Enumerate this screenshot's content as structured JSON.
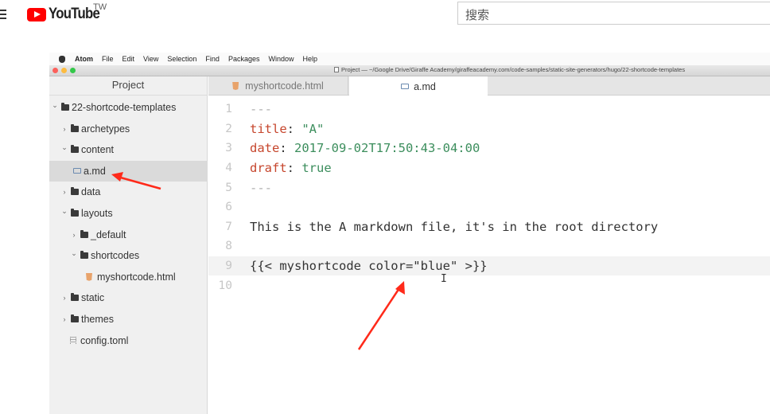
{
  "youtube": {
    "logo_text": "YouTube",
    "region": "TW",
    "search_placeholder": "搜索"
  },
  "menubar": {
    "items": [
      "Atom",
      "File",
      "Edit",
      "View",
      "Selection",
      "Find",
      "Packages",
      "Window",
      "Help"
    ]
  },
  "window": {
    "title": "Project — ~/Google Drive/Giraffe Academy/giraffeacademy.com/code-samples/static-site-generators/hugo/22-shortcode-templates"
  },
  "tree": {
    "header": "Project",
    "rows": [
      {
        "label": "22-shortcode-templates",
        "icon": "folder-icon",
        "chevron": "down"
      },
      {
        "label": "archetypes",
        "icon": "folder-icon",
        "chevron": "right"
      },
      {
        "label": "content",
        "icon": "folder-icon",
        "chevron": "down"
      },
      {
        "label": "a.md",
        "icon": "markdown-file-icon",
        "chevron": "",
        "selected": true
      },
      {
        "label": "data",
        "icon": "folder-icon",
        "chevron": "right"
      },
      {
        "label": "layouts",
        "icon": "folder-icon",
        "chevron": "down"
      },
      {
        "label": "_default",
        "icon": "folder-icon",
        "chevron": "right"
      },
      {
        "label": "shortcodes",
        "icon": "folder-icon",
        "chevron": "down"
      },
      {
        "label": "myshortcode.html",
        "icon": "html-file-icon",
        "chevron": ""
      },
      {
        "label": "static",
        "icon": "folder-icon",
        "chevron": "right"
      },
      {
        "label": "themes",
        "icon": "folder-icon",
        "chevron": "right"
      },
      {
        "label": "config.toml",
        "icon": "config-file-icon",
        "chevron": ""
      }
    ]
  },
  "tabs": [
    {
      "label": "myshortcode.html",
      "icon": "html-file-icon",
      "active": false
    },
    {
      "label": "a.md",
      "icon": "markdown-file-icon",
      "active": true
    }
  ],
  "editor": {
    "lines": [
      {
        "n": "1",
        "parts": [
          {
            "t": "---",
            "c": "dash"
          }
        ]
      },
      {
        "n": "2",
        "parts": [
          {
            "t": "title",
            "c": "k"
          },
          {
            "t": ": ",
            "c": ""
          },
          {
            "t": "\"A\"",
            "c": "s"
          }
        ]
      },
      {
        "n": "3",
        "parts": [
          {
            "t": "date",
            "c": "k"
          },
          {
            "t": ": ",
            "c": ""
          },
          {
            "t": "2017-09-02T17:50:43-04:00",
            "c": "s"
          }
        ]
      },
      {
        "n": "4",
        "parts": [
          {
            "t": "draft",
            "c": "k"
          },
          {
            "t": ": ",
            "c": ""
          },
          {
            "t": "true",
            "c": "s"
          }
        ]
      },
      {
        "n": "5",
        "parts": [
          {
            "t": "---",
            "c": "dash"
          }
        ]
      },
      {
        "n": "6",
        "parts": []
      },
      {
        "n": "7",
        "parts": [
          {
            "t": "This is the A markdown file, it's in the root directory",
            "c": ""
          }
        ]
      },
      {
        "n": "8",
        "parts": []
      },
      {
        "n": "9",
        "parts": [
          {
            "t": "{{< myshortcode color=\"blue\" >}}",
            "c": ""
          }
        ],
        "current": true
      },
      {
        "n": "10",
        "parts": []
      }
    ]
  },
  "colors": {
    "annotation_arrow": "#ff2a1a",
    "youtube_red": "#ff0000",
    "yaml_key": "#c6462d",
    "yaml_value": "#3c8e5d"
  }
}
